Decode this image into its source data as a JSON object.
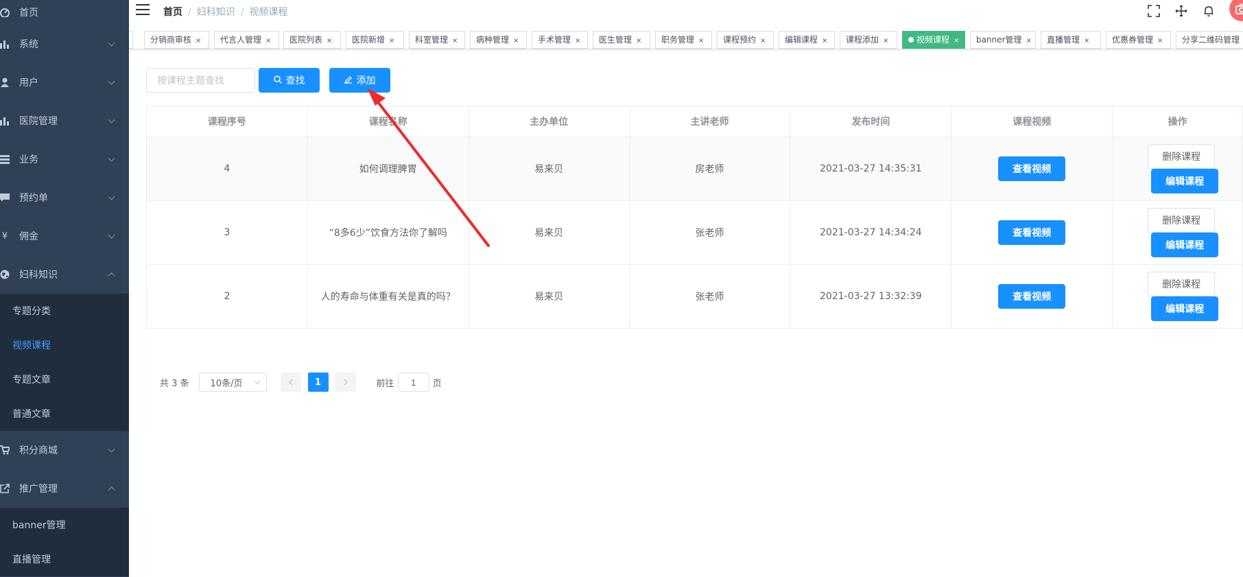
{
  "sidebar": {
    "items": [
      {
        "label": "首页",
        "icon": "dashboard-icon"
      },
      {
        "label": "系统",
        "icon": "chart-icon"
      },
      {
        "label": "用户",
        "icon": "user-icon"
      },
      {
        "label": "医院管理",
        "icon": "chart-icon"
      },
      {
        "label": "业务",
        "icon": "list-icon"
      },
      {
        "label": "预约单",
        "icon": "message-icon"
      },
      {
        "label": "佣金",
        "icon": "yen-icon"
      },
      {
        "label": "妇科知识",
        "icon": "globe-icon"
      }
    ],
    "gyne_sub": [
      "专题分类",
      "视频课程",
      "专题文章",
      "普通文章"
    ],
    "items2": [
      {
        "label": "积分商城",
        "icon": "cart-icon"
      },
      {
        "label": "推广管理",
        "icon": "share-icon"
      }
    ],
    "promo_sub": [
      "banner管理",
      "直播管理"
    ]
  },
  "header": {
    "breadcrumb": [
      "首页",
      "妇科知识",
      "视频课程"
    ],
    "separator": "/"
  },
  "tags": [
    {
      "label": "分销商审核"
    },
    {
      "label": "代言人管理"
    },
    {
      "label": "医院列表"
    },
    {
      "label": "医院新增"
    },
    {
      "label": "科室管理"
    },
    {
      "label": "病种管理"
    },
    {
      "label": "手术管理"
    },
    {
      "label": "医生管理"
    },
    {
      "label": "职务管理"
    },
    {
      "label": "课程预约"
    },
    {
      "label": "编辑课程"
    },
    {
      "label": "课程添加"
    },
    {
      "label": "视频课程",
      "active": true
    },
    {
      "label": "banner管理"
    },
    {
      "label": "直播管理"
    },
    {
      "label": "优惠券管理"
    },
    {
      "label": "分享二维码管理"
    }
  ],
  "filter": {
    "placeholder": "按课程主题查找",
    "search_label": "查找",
    "add_label": "添加"
  },
  "table": {
    "headers": [
      "课程序号",
      "课程名称",
      "主办单位",
      "主讲老师",
      "发布时间",
      "课程视频",
      "操作"
    ],
    "rows": [
      {
        "id": "4",
        "name": "如何调理脾胃",
        "org": "易来贝",
        "teacher": "房老师",
        "time": "2021-03-27 14:35:31"
      },
      {
        "id": "3",
        "name": "“8多6少”饮食方法你了解吗",
        "org": "易来贝",
        "teacher": "张老师",
        "time": "2021-03-27 14:34:24"
      },
      {
        "id": "2",
        "name": "人的寿命与体重有关是真的吗？",
        "org": "易来贝",
        "teacher": "张老师",
        "time": "2021-03-27 13:32:39"
      }
    ],
    "view_label": "查看视频",
    "delete_label": "删除课程",
    "edit_label": "编辑课程"
  },
  "pagination": {
    "total": "共 3 条",
    "page_size": "10条/页",
    "current": "1",
    "goto_prefix": "前往",
    "goto_value": "1",
    "goto_suffix": "页"
  },
  "colors": {
    "sidebar_bg": "#304156",
    "submenu_bg": "#1f2d3d",
    "primary": "#1890ff",
    "active_tag": "#42b983",
    "arrow": "#ee2b2b"
  }
}
